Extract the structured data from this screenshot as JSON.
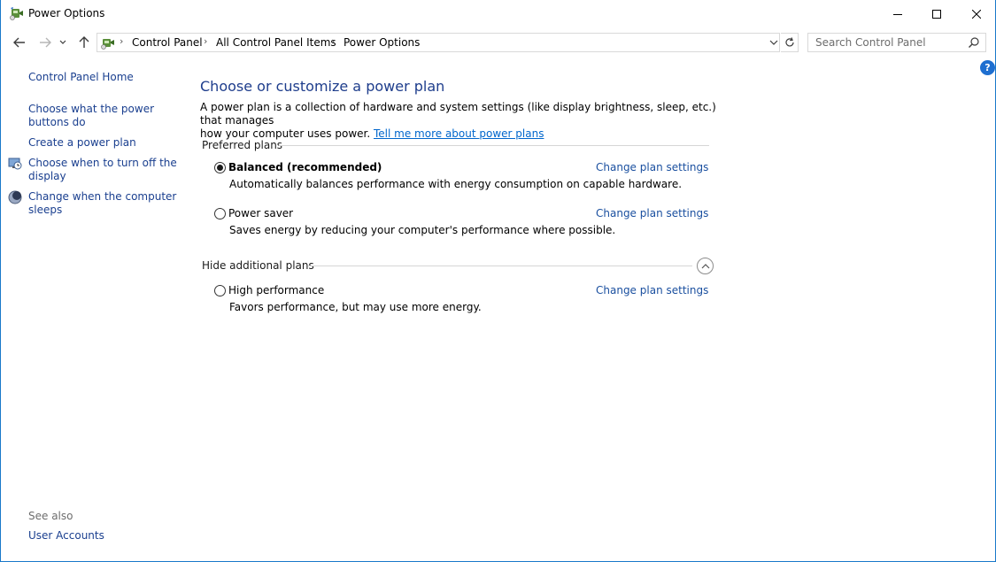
{
  "window": {
    "title": "Power Options",
    "icon": "power-options-icon",
    "controls": {
      "minimize": "minimize-icon",
      "maximize": "maximize-icon",
      "close": "close-icon"
    }
  },
  "nav": {
    "breadcrumb": [
      "Control Panel",
      "All Control Panel Items",
      "Power Options"
    ],
    "search_placeholder": "Search Control Panel"
  },
  "sidebar": {
    "home": "Control Panel Home",
    "links": [
      {
        "line1": "Choose what the power",
        "line2": "buttons do",
        "icon": ""
      },
      {
        "line1": "Create a power plan",
        "line2": "",
        "icon": ""
      },
      {
        "line1": "Choose when to turn off the",
        "line2": "display",
        "icon": "display-clock-icon"
      },
      {
        "line1": "Change when the computer",
        "line2": "sleeps",
        "icon": "sleep-moon-icon"
      }
    ],
    "see_also": "See also",
    "user_accounts": "User Accounts"
  },
  "main": {
    "heading": "Choose or customize a power plan",
    "description_line1": "A power plan is a collection of hardware and system settings (like display brightness, sleep, etc.) that manages",
    "description_line2": "how your computer uses power.",
    "description_link": "Tell me more about power plans",
    "preferred_label": "Preferred plans",
    "additional_label": "Hide additional plans",
    "change_link": "Change plan settings",
    "plans": [
      {
        "name": "Balanced (recommended)",
        "desc": "Automatically balances performance with energy consumption on capable hardware.",
        "selected": true
      },
      {
        "name": "Power saver",
        "desc": "Saves energy by reducing your computer's performance where possible.",
        "selected": false
      },
      {
        "name": "High performance",
        "desc": "Favors performance, but may use more energy.",
        "selected": false
      }
    ]
  },
  "colors": {
    "link": "#1a4f9f",
    "heading": "#1e3d8c",
    "accent": "#1979ca"
  }
}
